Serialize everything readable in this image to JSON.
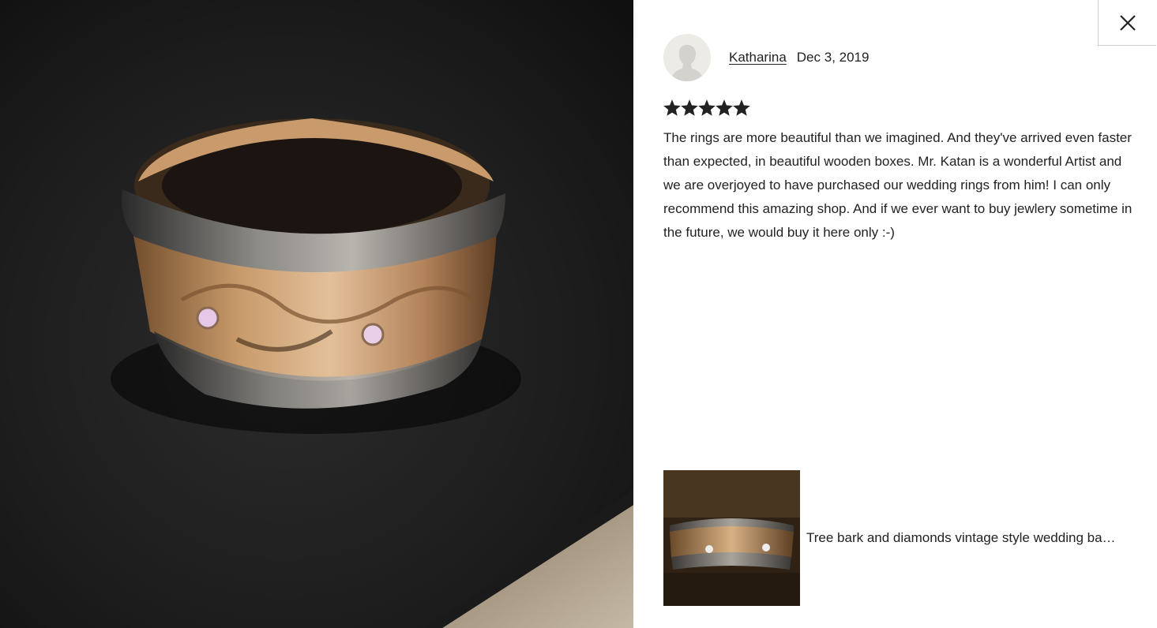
{
  "photo": {
    "icon": "ring-photo"
  },
  "close": {
    "icon": "close-icon"
  },
  "reviewer": {
    "name": "Katharina",
    "date": "Dec 3, 2019",
    "avatar_icon": "user-silhouette-icon"
  },
  "review": {
    "rating": 5,
    "rating_max": 5,
    "star_color": "#222222",
    "text": "The rings are more beautiful than we imagined. And they've arrived even faster than expected, in beautiful wooden boxes. Mr. Katan is a wonderful Artist and we are overjoyed to have purchased our wedding rings from him! I can only recommend this amazing shop. And if we ever want to buy jewlery sometime in the future, we would buy it here only :-)"
  },
  "listing": {
    "title": "Tree bark and diamonds vintage style wedding ba…"
  }
}
